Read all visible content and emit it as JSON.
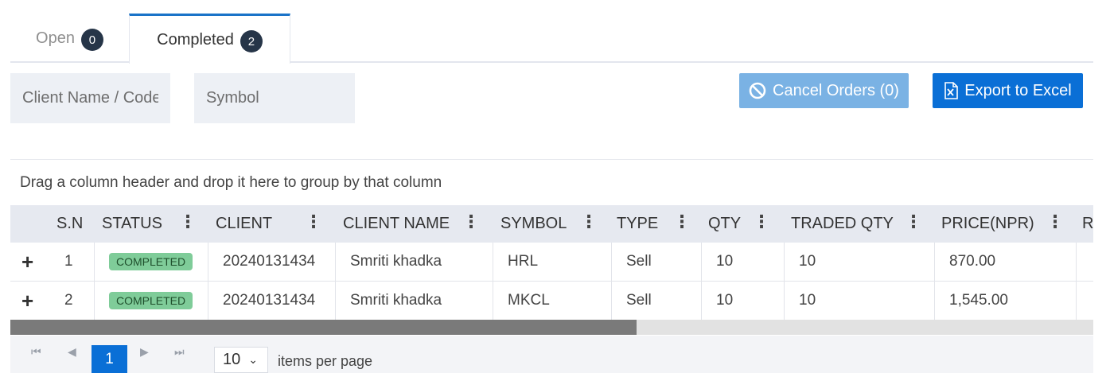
{
  "tabs": [
    {
      "label": "Open",
      "count": "0"
    },
    {
      "label": "Completed",
      "count": "2"
    }
  ],
  "filters": {
    "client_placeholder": "Client Name / Code",
    "symbol_placeholder": "Symbol"
  },
  "actions": {
    "cancel_label": "Cancel Orders (0)",
    "export_label": "Export to Excel"
  },
  "group_panel": "Drag a column header and drop it here to group by that column",
  "columns": [
    "S.N",
    "STATUS",
    "CLIENT",
    "CLIENT NAME",
    "SYMBOL",
    "TYPE",
    "QTY",
    "TRADED QTY",
    "PRICE(NPR)",
    "R"
  ],
  "rows": [
    {
      "sn": "1",
      "status": "COMPLETED",
      "client": "20240131434",
      "client_name": "Smriti khadka",
      "symbol": "HRL",
      "type": "Sell",
      "qty": "10",
      "traded_qty": "10",
      "price": "870.00"
    },
    {
      "sn": "2",
      "status": "COMPLETED",
      "client": "20240131434",
      "client_name": "Smriti khadka",
      "symbol": "MKCL",
      "type": "Sell",
      "qty": "10",
      "traded_qty": "10",
      "price": "1,545.00"
    }
  ],
  "pager": {
    "current_page": "1",
    "page_size": "10",
    "items_per_page_label": "items per page"
  },
  "colors": {
    "accent": "#0a6fd6",
    "badge": "#263548",
    "status_completed": "#7fcc99"
  }
}
